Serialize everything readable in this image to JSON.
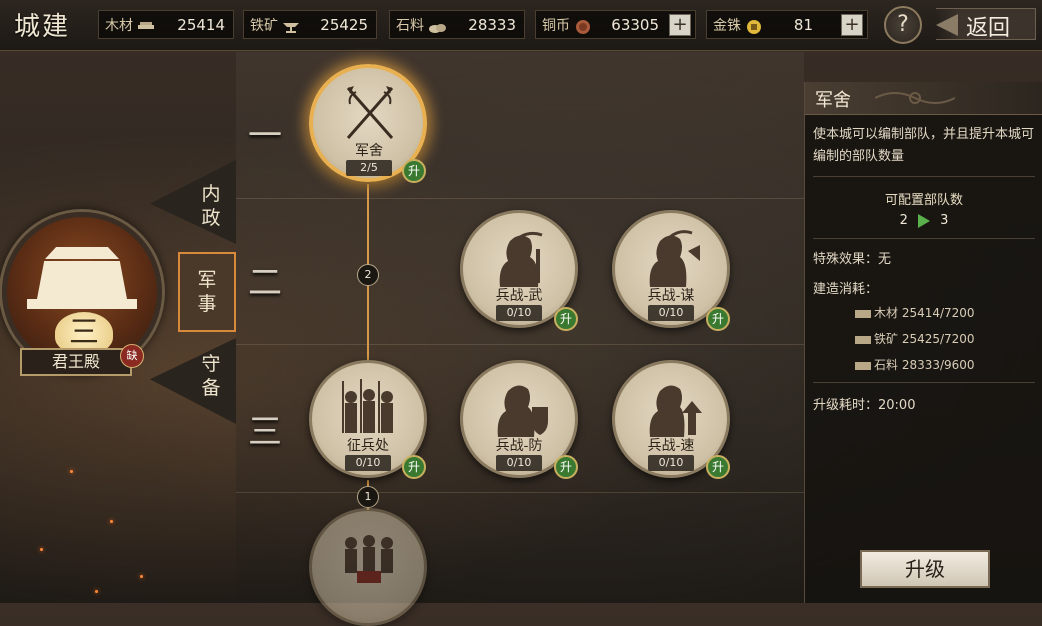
{
  "header": {
    "title": "城建",
    "back_label": "返回",
    "help_label": "?"
  },
  "resources": [
    {
      "label": "木材",
      "value": "25414",
      "icon": "wood-icon",
      "has_plus": false
    },
    {
      "label": "铁矿",
      "value": "25425",
      "icon": "anvil-icon",
      "has_plus": false
    },
    {
      "label": "石料",
      "value": "28333",
      "icon": "stone-icon",
      "has_plus": false
    },
    {
      "label": "铜币",
      "value": "63305",
      "icon": "copper-coin-icon",
      "has_plus": true
    },
    {
      "label": "金铢",
      "value": "81",
      "icon": "gold-coin-icon",
      "has_plus": true
    }
  ],
  "palace": {
    "level": "三",
    "name": "君王殿",
    "badge": "缺"
  },
  "side_tabs": [
    {
      "label": "内政",
      "active": false
    },
    {
      "label": "军事",
      "active": true
    },
    {
      "label": "守备",
      "active": false
    }
  ],
  "tiers": [
    "一",
    "二",
    "三"
  ],
  "connectors": [
    "2",
    "1"
  ],
  "nodes": {
    "barracks": {
      "name": "军舍",
      "level": "2/5",
      "upgrade": "升"
    },
    "war_wu": {
      "name": "兵战-武",
      "level": "0/10",
      "upgrade": "升"
    },
    "war_mou": {
      "name": "兵战-谋",
      "level": "0/10",
      "upgrade": "升"
    },
    "recruit": {
      "name": "征兵处",
      "level": "0/10",
      "upgrade": "升"
    },
    "war_fang": {
      "name": "兵战-防",
      "level": "0/10",
      "upgrade": "升"
    },
    "war_su": {
      "name": "兵战-速",
      "level": "0/10",
      "upgrade": "升"
    }
  },
  "info": {
    "title": "军舍",
    "description": "使本城可以编制部队，并且提升本城可编制的部队数量",
    "capacity_label": "可配置部队数",
    "capacity_from": "2",
    "capacity_to": "3",
    "effect": "特殊效果：无",
    "cost_label": "建造消耗：",
    "costs": [
      {
        "text": "木材 25414/7200",
        "icon": "wood-icon"
      },
      {
        "text": "铁矿 25425/7200",
        "icon": "anvil-icon"
      },
      {
        "text": "石料 28333/9600",
        "icon": "stone-icon"
      }
    ],
    "time": "升级耗时：20:00",
    "upgrade_label": "升级"
  }
}
